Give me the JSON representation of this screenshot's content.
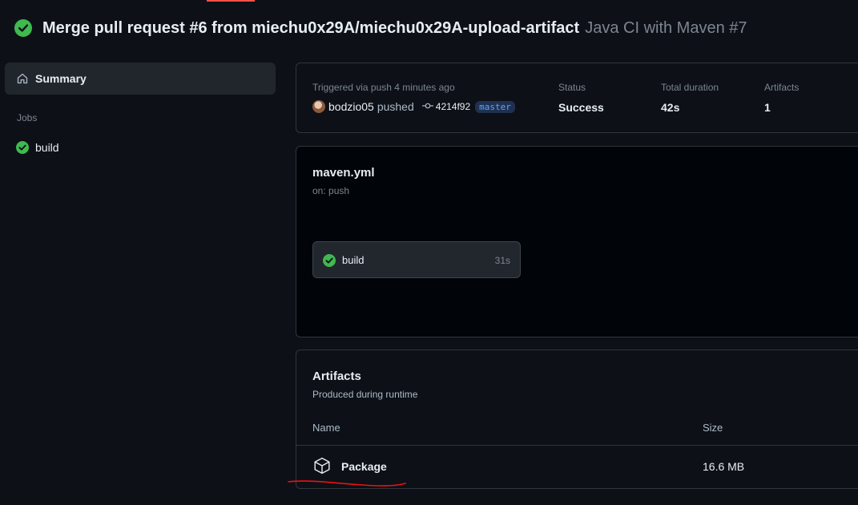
{
  "run": {
    "title": "Merge pull request #6 from miechu0x29A/miechu0x29A-upload-artifact",
    "workflow_label": "Java CI with Maven #7",
    "status_icon": "check-circle-icon",
    "accent_color": "#3fb950"
  },
  "sidebar": {
    "summary_label": "Summary",
    "jobs_heading": "Jobs",
    "jobs": [
      {
        "label": "build"
      }
    ]
  },
  "summary": {
    "triggered": "Triggered via push 4 minutes ago",
    "actor": "bodzio05",
    "action": "pushed",
    "commit_sha": "4214f92",
    "branch": "master",
    "status_label": "Status",
    "status_value": "Success",
    "duration_label": "Total duration",
    "duration_value": "42s",
    "artifacts_label": "Artifacts",
    "artifacts_value": "1"
  },
  "workflow": {
    "file": "maven.yml",
    "trigger": "on: push",
    "jobs": [
      {
        "name": "build",
        "duration": "31s"
      }
    ]
  },
  "artifacts": {
    "title": "Artifacts",
    "subtitle": "Produced during runtime",
    "columns": {
      "name": "Name",
      "size": "Size"
    },
    "rows": [
      {
        "name": "Package",
        "size": "16.6 MB"
      }
    ]
  }
}
